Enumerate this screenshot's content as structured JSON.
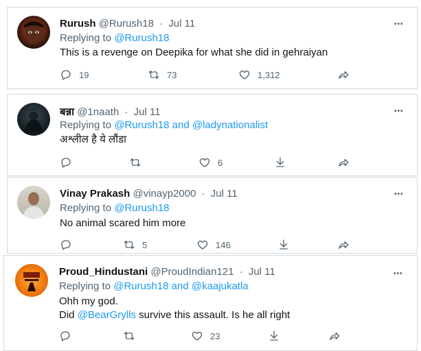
{
  "tweets": [
    {
      "name": "Rurush",
      "handle": "@Rurush18",
      "date": "Jul 11",
      "replying_prefix": "Replying to ",
      "mentions": [
        "@Rurush18"
      ],
      "join_word": "",
      "lines": [
        "This is a revenge on Deepika for what she did in gehraiyan"
      ],
      "reply_count": "19",
      "retweet_count": "73",
      "like_count": "1,312"
    },
    {
      "name": "बन्ना",
      "handle": "@1naath",
      "date": "Jul 11",
      "replying_prefix": "Replying to ",
      "mentions": [
        "@Rurush18",
        "@ladynationalist"
      ],
      "join_word": " and ",
      "lines": [
        "अश्लील है ये लौंडा"
      ],
      "reply_count": "",
      "retweet_count": "",
      "like_count": "6"
    },
    {
      "name": "Vinay Prakash",
      "handle": "@vinayp2000",
      "date": "Jul 11",
      "replying_prefix": "Replying to ",
      "mentions": [
        "@Rurush18"
      ],
      "join_word": "",
      "lines": [
        "No animal scared him more"
      ],
      "reply_count": "",
      "retweet_count": "5",
      "like_count": "146"
    },
    {
      "name": "Proud_Hindustani",
      "handle": "@ProudIndian121",
      "date": "Jul 11",
      "replying_prefix": "Replying to ",
      "mentions": [
        "@Rurush18",
        "@kaajukatla"
      ],
      "join_word": " and ",
      "lines": [
        "Ohh my god."
      ],
      "line2_prefix": "Did ",
      "line2_mention": "@BearGrylls",
      "line2_suffix": " survive this assault. Is he all right",
      "reply_count": "",
      "retweet_count": "",
      "like_count": "23"
    }
  ],
  "ui": {
    "separator": "·",
    "more_glyph": "•••"
  },
  "colors": {
    "link": "#1d9bf0",
    "secondary": "#536471",
    "primary": "#0f1419",
    "border": "#cfd9de"
  }
}
